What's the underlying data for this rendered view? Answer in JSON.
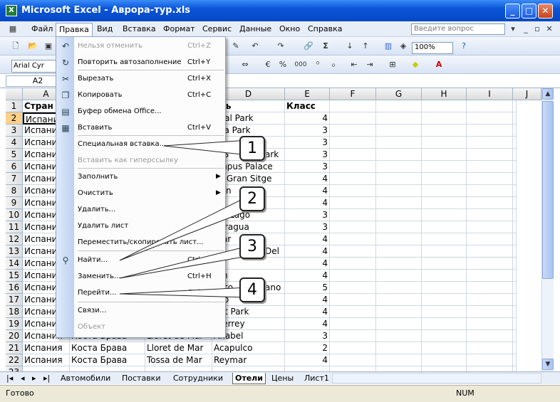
{
  "window": {
    "title": "Microsoft Excel - Аврора-тур.xls",
    "app_icon": "excel-icon"
  },
  "menubar": {
    "items": [
      "Файл",
      "Правка",
      "Вид",
      "Вставка",
      "Формат",
      "Сервис",
      "Данные",
      "Окно",
      "Справка"
    ],
    "ask_placeholder": "Введите вопрос"
  },
  "toolbar": {
    "font": "Arial Cyr",
    "zoom": "100%",
    "percent": "%",
    "thousands": "000"
  },
  "formula_bar": {
    "namebox": "A2"
  },
  "grid": {
    "columns": [
      "A",
      "B",
      "C",
      "D",
      "E",
      "F",
      "G",
      "H",
      "I",
      "J"
    ],
    "row_numbers": [
      "1",
      "2",
      "3",
      "4",
      "5",
      "6",
      "7",
      "8",
      "9",
      "10",
      "11",
      "12",
      "13",
      "14",
      "15",
      "16",
      "17",
      "18",
      "19",
      "20",
      "21",
      "22",
      "23"
    ],
    "header_row": {
      "a": "Стран",
      "d": "ель",
      "e": "Класс"
    },
    "col_a_value": "Испани",
    "d_values": [
      "tival Park",
      "aya Park",
      "",
      "rt S",
      "ympus Palace",
      "lia Gran Sitge",
      "rran",
      "lin",
      "sta Lago",
      "naragua",
      "rvar",
      "lia",
      "ay",
      "ton",
      "ento",
      "uso",
      "gat Park",
      "nterrey",
      "rabel"
    ],
    "e_values": [
      "4",
      "3",
      "3",
      "3",
      "3",
      "4",
      "4",
      "4",
      "3",
      "3",
      "4",
      "4",
      "4",
      "4",
      "5",
      "4",
      "4",
      "4",
      "3",
      "2",
      "4",
      ""
    ],
    "visible_fragments": {
      "d5_right": "ark",
      "d13_right": "Del",
      "d16_right": "ano"
    },
    "bottom_rows": [
      {
        "num": "20",
        "a": "Испания",
        "b": "Коста Брава",
        "c": "Lloret de Mar",
        "d": "Anabel",
        "e": "3"
      },
      {
        "num": "21",
        "a": "Испания",
        "b": "Коста Брава",
        "c": "Lloret de Mar",
        "d": "Acapulco",
        "e": "2"
      },
      {
        "num": "22",
        "a": "Испания",
        "b": "Коста Брава",
        "c": "Tossa de Mar",
        "d": "Reymar",
        "e": "4"
      }
    ]
  },
  "edit_menu": {
    "items": [
      {
        "label": "Нельзя отменить",
        "shortcut": "Ctrl+Z",
        "disabled": true,
        "icon": "undo-icon"
      },
      {
        "label": "Повторить автозаполнение",
        "shortcut": "Ctrl+Y",
        "disabled": false,
        "icon": "redo-icon"
      },
      {
        "label": "Вырезать",
        "shortcut": "Ctrl+X",
        "disabled": false,
        "icon": "cut-icon"
      },
      {
        "label": "Копировать",
        "shortcut": "Ctrl+C",
        "disabled": false,
        "icon": "copy-icon"
      },
      {
        "label": "Буфер обмена Office...",
        "shortcut": "",
        "disabled": false,
        "icon": "clipboard-icon"
      },
      {
        "label": "Вставить",
        "shortcut": "Ctrl+V",
        "disabled": false,
        "icon": "paste-icon"
      },
      {
        "label": "Специальная вставка...",
        "shortcut": "",
        "disabled": false,
        "icon": ""
      },
      {
        "label": "Вставить как гиперссылку",
        "shortcut": "",
        "disabled": true,
        "icon": ""
      },
      {
        "label": "Заполнить",
        "shortcut": "",
        "disabled": false,
        "icon": "",
        "submenu": true
      },
      {
        "label": "Очистить",
        "shortcut": "",
        "disabled": false,
        "icon": "",
        "submenu": true
      },
      {
        "label": "Удалить...",
        "shortcut": "",
        "disabled": false,
        "icon": ""
      },
      {
        "label": "Удалить лист",
        "shortcut": "",
        "disabled": false,
        "icon": ""
      },
      {
        "label": "Переместить/скопировать лист...",
        "shortcut": "",
        "disabled": false,
        "icon": ""
      },
      {
        "label": "Найти...",
        "shortcut": "Ctrl",
        "disabled": false,
        "icon": "find-icon"
      },
      {
        "label": "Заменить...",
        "shortcut": "Ctrl+H",
        "disabled": false,
        "icon": ""
      },
      {
        "label": "Перейти...",
        "shortcut": "Ctrl+G",
        "disabled": false,
        "icon": ""
      },
      {
        "label": "Связи...",
        "shortcut": "",
        "disabled": false,
        "icon": ""
      },
      {
        "label": "Объект",
        "shortcut": "",
        "disabled": true,
        "icon": ""
      }
    ]
  },
  "callouts": [
    "1",
    "2",
    "3",
    "4"
  ],
  "sheet_tabs": [
    "Автомобили",
    "Поставки",
    "Сотрудники",
    "Отели",
    "Цены",
    "Лист1"
  ],
  "active_tab": "Отели",
  "status": {
    "left": "Готово",
    "num": "NUM"
  }
}
